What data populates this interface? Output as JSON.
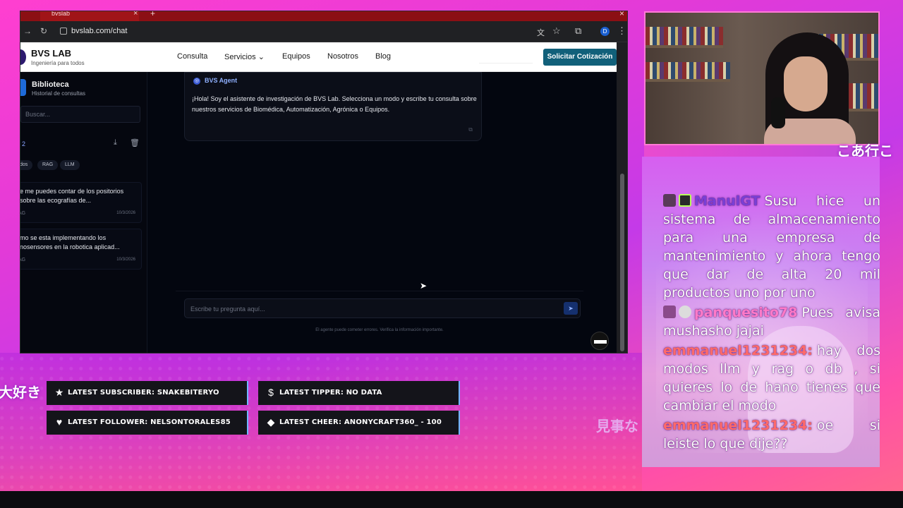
{
  "browser": {
    "tab_title": "bvslab",
    "url": "bvslab.com/chat",
    "profile_initial": "D"
  },
  "site": {
    "brand": "BVS LAB",
    "tagline": "Ingeniería para todos",
    "nav": {
      "consulta": "Consulta",
      "servicios": "Servicios",
      "equipos": "Equipos",
      "nosotros": "Nosotros",
      "blog": "Blog"
    },
    "cta": "Solicitar Cotización"
  },
  "sidebar": {
    "title": "Biblioteca",
    "subtitle": "Historial de consultas",
    "search_placeholder": "Buscar...",
    "count": "2",
    "filters": [
      "dos",
      "RAG",
      "LLM"
    ],
    "history": [
      {
        "text": "e me puedes contar de los positorios sobre las ecografías de...",
        "tag": "AG",
        "date": "10/3/2026"
      },
      {
        "text": "mo se esta implementando los nosensores en la robotica aplicad...",
        "tag": "AG",
        "date": "10/3/2026"
      }
    ]
  },
  "chat": {
    "agent_name": "BVS Agent",
    "agent_message": "¡Hola! Soy el asistente de investigación de BVS Lab. Selecciona un modo y escribe tu consulta sobre nuestros servicios de Biomédica, Automatización, Agrónica o Equipos.",
    "input_placeholder": "Escribe tu pregunta aquí...",
    "disclaimer": "El agente puede cometer errores. Verifica la información importante."
  },
  "alerts": {
    "subscriber": "LATEST SUBSCRIBER: SNAKEBITERYO",
    "tipper": "LATEST TIPPER: NO DATA",
    "follower": "LATEST FOLLOWER: NELSONTORALES85",
    "cheer": "LATEST CHEER: ANONYCRAFT360_ - 100"
  },
  "overlay_text": {
    "left": "大好き",
    "right": "見事な",
    "top": "こあ行こ"
  },
  "stream_chat": [
    {
      "user": "ManulGT",
      "user_color": "#7a3fd6",
      "message": "Susu hice un sistema de almacenamiento para una empresa de mantenimiento y ahora tengo que dar de alta 20 mil productos uno por uno"
    },
    {
      "user": "panquesito78",
      "user_color": "#ff7ac8",
      "message": "Pues avisa mushasho jajai"
    },
    {
      "user": "emmanuel1231234:",
      "user_color": "#ff6a6a",
      "message": "hay dos modos llm y rag o db , si quieres lo de hano tienes que cambiar el modo"
    },
    {
      "user": "emmanuel1231234:",
      "user_color": "#ff6a6a",
      "message": "oe si leiste lo que dije??"
    }
  ],
  "colors": {
    "cta": "#11607a",
    "agent_accent": "#8fb0ff",
    "alert_border": "#6fb6ff"
  },
  "icons": {
    "subscriber": "star-icon",
    "tipper": "dollar-icon",
    "follower": "heart-icon",
    "cheer": "diamond-icon"
  }
}
